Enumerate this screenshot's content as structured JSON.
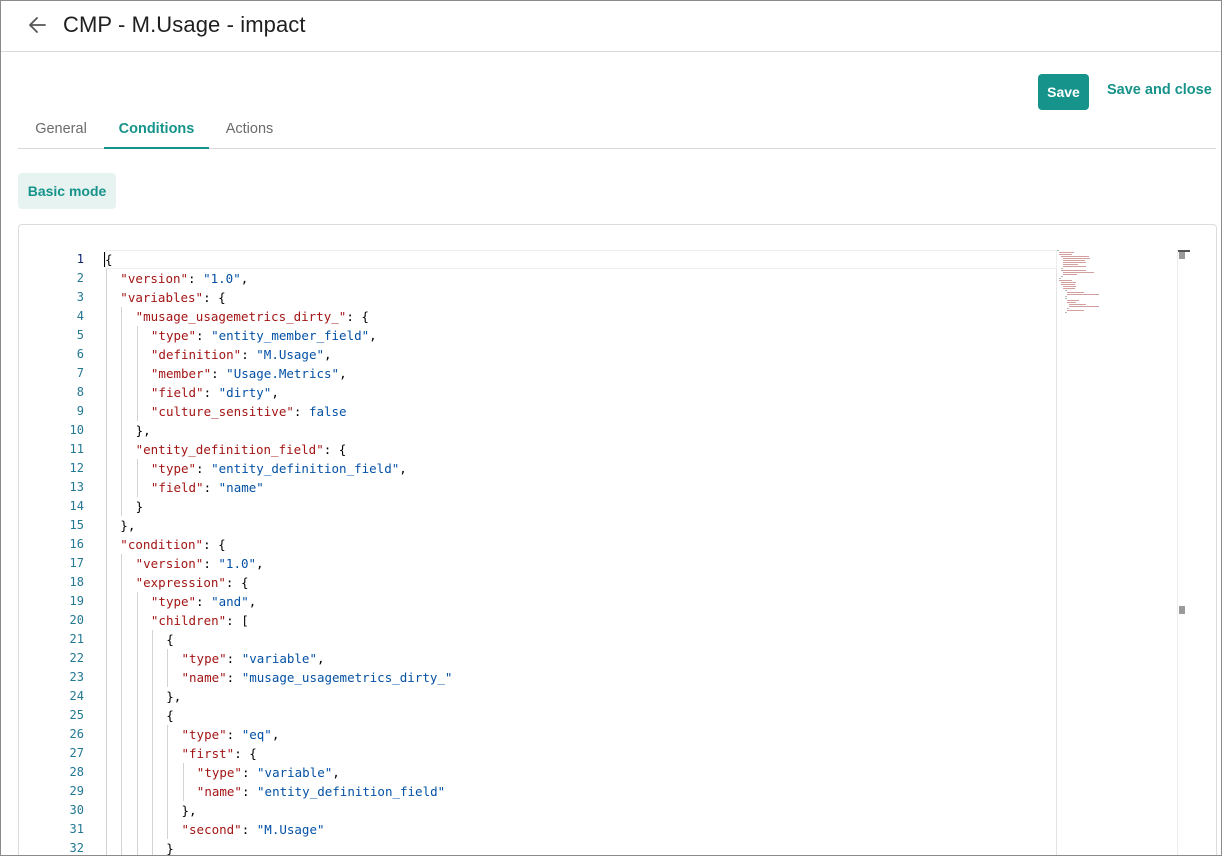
{
  "header": {
    "title": "CMP - M.Usage - impact",
    "back_icon": "arrow-left-icon"
  },
  "actions": {
    "save_label": "Save",
    "save_close_label": "Save and close"
  },
  "colors": {
    "accent": "#16938a",
    "accent_light": "#e6f3f1",
    "json_key": "#a31515",
    "json_string": "#0451a5",
    "line_number": "#237893"
  },
  "tabs": [
    {
      "label": "General",
      "active": false
    },
    {
      "label": "Conditions",
      "active": true
    },
    {
      "label": "Actions",
      "active": false
    }
  ],
  "mode_button": "Basic mode",
  "editor": {
    "language": "json",
    "active_line": 1,
    "lines": [
      {
        "n": "1",
        "d": 0,
        "t": [
          [
            "p",
            "{"
          ]
        ]
      },
      {
        "n": "2",
        "d": 1,
        "t": [
          [
            "k",
            "\"version\""
          ],
          [
            "p",
            ": "
          ],
          [
            "s",
            "\"1.0\""
          ],
          [
            "p",
            ","
          ]
        ]
      },
      {
        "n": "3",
        "d": 1,
        "t": [
          [
            "k",
            "\"variables\""
          ],
          [
            "p",
            ": {"
          ]
        ]
      },
      {
        "n": "4",
        "d": 2,
        "t": [
          [
            "k",
            "\"musage_usagemetrics_dirty_\""
          ],
          [
            "p",
            ": {"
          ]
        ]
      },
      {
        "n": "5",
        "d": 3,
        "t": [
          [
            "k",
            "\"type\""
          ],
          [
            "p",
            ": "
          ],
          [
            "s",
            "\"entity_member_field\""
          ],
          [
            "p",
            ","
          ]
        ]
      },
      {
        "n": "6",
        "d": 3,
        "t": [
          [
            "k",
            "\"definition\""
          ],
          [
            "p",
            ": "
          ],
          [
            "s",
            "\"M.Usage\""
          ],
          [
            "p",
            ","
          ]
        ]
      },
      {
        "n": "7",
        "d": 3,
        "t": [
          [
            "k",
            "\"member\""
          ],
          [
            "p",
            ": "
          ],
          [
            "s",
            "\"Usage.Metrics\""
          ],
          [
            "p",
            ","
          ]
        ]
      },
      {
        "n": "8",
        "d": 3,
        "t": [
          [
            "k",
            "\"field\""
          ],
          [
            "p",
            ": "
          ],
          [
            "s",
            "\"dirty\""
          ],
          [
            "p",
            ","
          ]
        ]
      },
      {
        "n": "9",
        "d": 3,
        "t": [
          [
            "k",
            "\"culture_sensitive\""
          ],
          [
            "p",
            ": "
          ],
          [
            "b",
            "false"
          ]
        ]
      },
      {
        "n": "10",
        "d": 2,
        "t": [
          [
            "p",
            "},"
          ]
        ]
      },
      {
        "n": "11",
        "d": 2,
        "t": [
          [
            "k",
            "\"entity_definition_field\""
          ],
          [
            "p",
            ": {"
          ]
        ]
      },
      {
        "n": "12",
        "d": 3,
        "t": [
          [
            "k",
            "\"type\""
          ],
          [
            "p",
            ": "
          ],
          [
            "s",
            "\"entity_definition_field\""
          ],
          [
            "p",
            ","
          ]
        ]
      },
      {
        "n": "13",
        "d": 3,
        "t": [
          [
            "k",
            "\"field\""
          ],
          [
            "p",
            ": "
          ],
          [
            "s",
            "\"name\""
          ]
        ]
      },
      {
        "n": "14",
        "d": 2,
        "t": [
          [
            "p",
            "}"
          ]
        ]
      },
      {
        "n": "15",
        "d": 1,
        "t": [
          [
            "p",
            "},"
          ]
        ]
      },
      {
        "n": "16",
        "d": 1,
        "t": [
          [
            "k",
            "\"condition\""
          ],
          [
            "p",
            ": {"
          ]
        ]
      },
      {
        "n": "17",
        "d": 2,
        "t": [
          [
            "k",
            "\"version\""
          ],
          [
            "p",
            ": "
          ],
          [
            "s",
            "\"1.0\""
          ],
          [
            "p",
            ","
          ]
        ]
      },
      {
        "n": "18",
        "d": 2,
        "t": [
          [
            "k",
            "\"expression\""
          ],
          [
            "p",
            ": {"
          ]
        ]
      },
      {
        "n": "19",
        "d": 3,
        "t": [
          [
            "k",
            "\"type\""
          ],
          [
            "p",
            ": "
          ],
          [
            "s",
            "\"and\""
          ],
          [
            "p",
            ","
          ]
        ]
      },
      {
        "n": "20",
        "d": 3,
        "t": [
          [
            "k",
            "\"children\""
          ],
          [
            "p",
            ": ["
          ]
        ]
      },
      {
        "n": "21",
        "d": 4,
        "t": [
          [
            "p",
            "{"
          ]
        ]
      },
      {
        "n": "22",
        "d": 5,
        "t": [
          [
            "k",
            "\"type\""
          ],
          [
            "p",
            ": "
          ],
          [
            "s",
            "\"variable\""
          ],
          [
            "p",
            ","
          ]
        ]
      },
      {
        "n": "23",
        "d": 5,
        "t": [
          [
            "k",
            "\"name\""
          ],
          [
            "p",
            ": "
          ],
          [
            "s",
            "\"musage_usagemetrics_dirty_\""
          ]
        ]
      },
      {
        "n": "24",
        "d": 4,
        "t": [
          [
            "p",
            "},"
          ]
        ]
      },
      {
        "n": "25",
        "d": 4,
        "t": [
          [
            "p",
            "{"
          ]
        ]
      },
      {
        "n": "26",
        "d": 5,
        "t": [
          [
            "k",
            "\"type\""
          ],
          [
            "p",
            ": "
          ],
          [
            "s",
            "\"eq\""
          ],
          [
            "p",
            ","
          ]
        ]
      },
      {
        "n": "27",
        "d": 5,
        "t": [
          [
            "k",
            "\"first\""
          ],
          [
            "p",
            ": {"
          ]
        ]
      },
      {
        "n": "28",
        "d": 6,
        "t": [
          [
            "k",
            "\"type\""
          ],
          [
            "p",
            ": "
          ],
          [
            "s",
            "\"variable\""
          ],
          [
            "p",
            ","
          ]
        ]
      },
      {
        "n": "29",
        "d": 6,
        "t": [
          [
            "k",
            "\"name\""
          ],
          [
            "p",
            ": "
          ],
          [
            "s",
            "\"entity_definition_field\""
          ]
        ]
      },
      {
        "n": "30",
        "d": 5,
        "t": [
          [
            "p",
            "},"
          ]
        ]
      },
      {
        "n": "31",
        "d": 5,
        "t": [
          [
            "k",
            "\"second\""
          ],
          [
            "p",
            ": "
          ],
          [
            "s",
            "\"M.Usage\""
          ]
        ]
      },
      {
        "n": "32",
        "d": 4,
        "t": [
          [
            "p",
            "}"
          ]
        ]
      }
    ]
  }
}
